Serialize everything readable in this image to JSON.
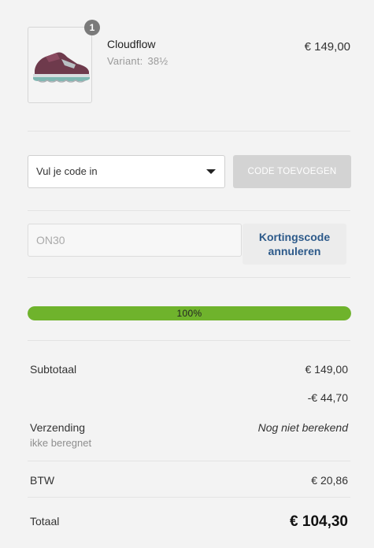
{
  "product": {
    "name": "Cloudflow",
    "variant_label": "Variant:",
    "variant_value": "38½",
    "price": "€ 149,00",
    "quantity": "1",
    "image_icon": "shoe-image"
  },
  "coupon": {
    "select_value": "Vul je code in",
    "add_button_label": "CODE TOEVOEGEN",
    "applied_code": "ON30",
    "cancel_line1": "Kortingscode",
    "cancel_line2": "annuleren"
  },
  "progress": {
    "percent": 100,
    "label": "100%",
    "color": "#6fb32c"
  },
  "totals": {
    "subtotal_label": "Subtotaal",
    "subtotal_value": "€ 149,00",
    "discount_value": "-€ 44,70",
    "shipping_label": "Verzending",
    "shipping_note": "ikke beregnet",
    "shipping_value": "Nog niet berekend",
    "vat_label": "BTW",
    "vat_value": "€ 20,86",
    "total_label": "Totaal",
    "total_value": "€ 104,30"
  }
}
